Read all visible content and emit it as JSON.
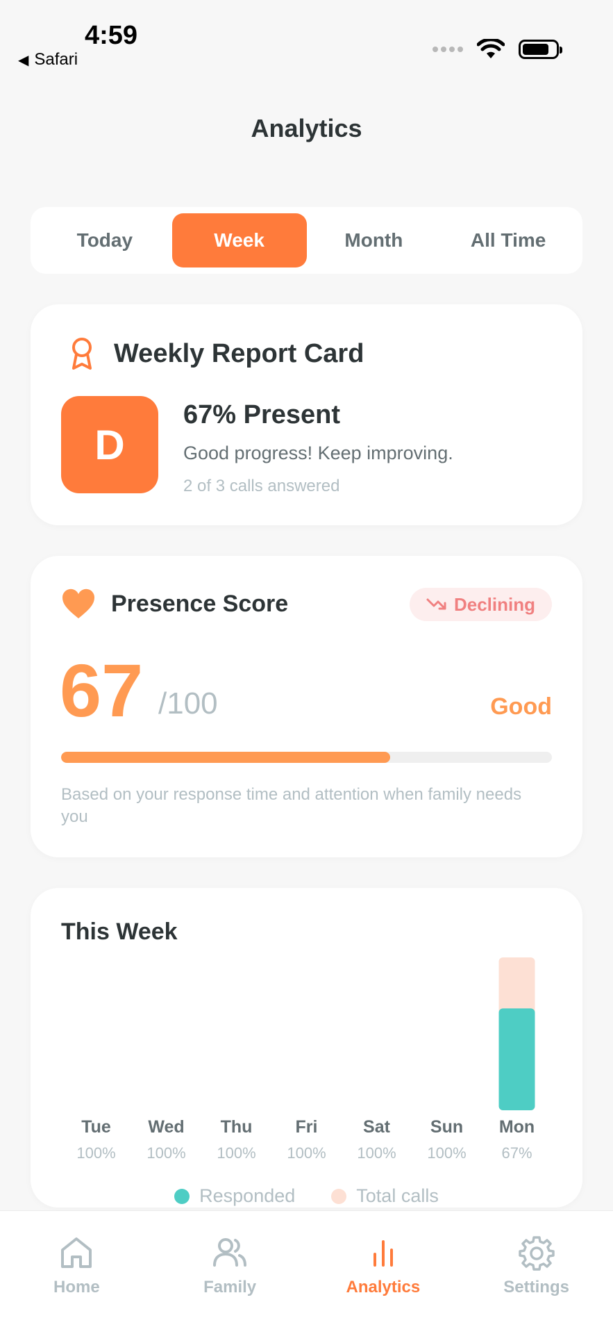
{
  "status": {
    "time": "4:59",
    "back_label": "Safari"
  },
  "title": "Analytics",
  "segments": [
    {
      "label": "Today",
      "active": false
    },
    {
      "label": "Week",
      "active": true
    },
    {
      "label": "Month",
      "active": false
    },
    {
      "label": "All Time",
      "active": false
    }
  ],
  "report_card": {
    "title": "Weekly Report Card",
    "grade": "D",
    "percent_text": "67% Present",
    "message": "Good progress! Keep improving.",
    "sub": "2 of 3 calls answered",
    "icon": "award-ribbon-icon"
  },
  "presence": {
    "title": "Presence Score",
    "icon": "heart-icon",
    "trend": "Declining",
    "trend_icon": "trend-down-icon",
    "score": "67",
    "max": "/100",
    "rating": "Good",
    "progress": 0.67,
    "note": "Based on your response time and attention when family needs you"
  },
  "week": {
    "title": "This Week",
    "legend": {
      "responded": "Responded",
      "total": "Total calls"
    }
  },
  "chart_data": {
    "type": "bar",
    "categories": [
      "Tue",
      "Wed",
      "Thu",
      "Fri",
      "Sat",
      "Sun",
      "Mon"
    ],
    "percent_labels": [
      "100%",
      "100%",
      "100%",
      "100%",
      "100%",
      "100%",
      "67%"
    ],
    "series": [
      {
        "name": "Responded",
        "values": [
          0,
          0,
          0,
          0,
          0,
          0,
          2
        ]
      },
      {
        "name": "Total calls",
        "values": [
          0,
          0,
          0,
          0,
          0,
          0,
          3
        ]
      }
    ],
    "legend_placement": "bottom",
    "grid": false
  },
  "colors": {
    "accent": "#ff7b3b",
    "score": "#ff9a52",
    "responded": "#4ecdc4",
    "total": "#fde0d4",
    "muted": "#b2bec3"
  },
  "tabs": [
    {
      "label": "Home",
      "icon": "home-icon",
      "active": false
    },
    {
      "label": "Family",
      "icon": "family-icon",
      "active": false
    },
    {
      "label": "Analytics",
      "icon": "bar-chart-icon",
      "active": true
    },
    {
      "label": "Settings",
      "icon": "gear-icon",
      "active": false
    }
  ]
}
